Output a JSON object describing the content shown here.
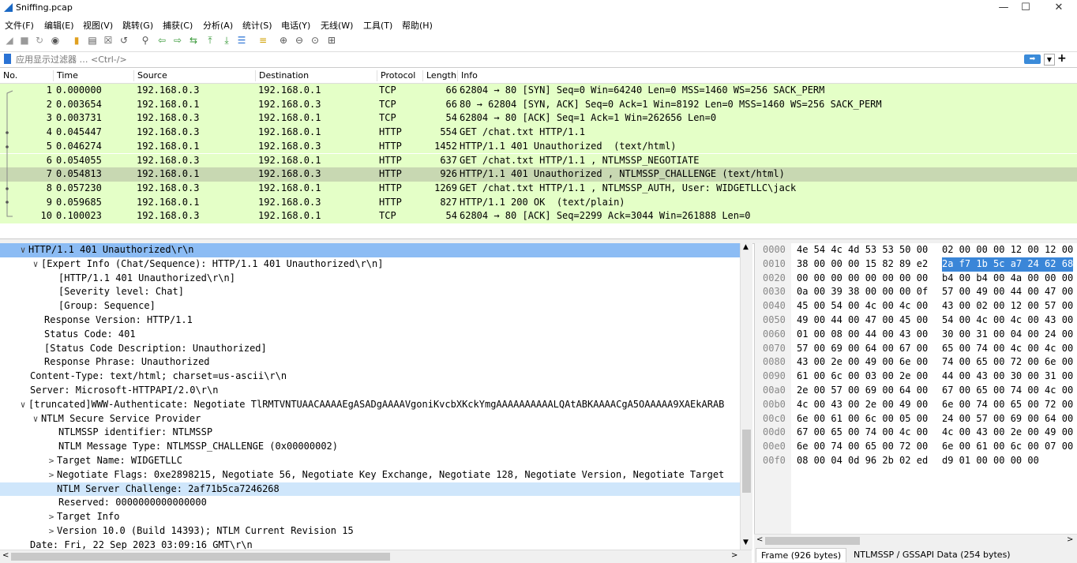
{
  "window": {
    "title": "Sniffing.pcap",
    "minimize": "—",
    "maximize": "☐",
    "close": "✕"
  },
  "menu": [
    "文件(F)",
    "编辑(E)",
    "视图(V)",
    "跳转(G)",
    "捕获(C)",
    "分析(A)",
    "统计(S)",
    "电话(Y)",
    "无线(W)",
    "工具(T)",
    "帮助(H)"
  ],
  "filter": {
    "placeholder": "应用显示过滤器 … <Ctrl-/>",
    "plus": "+"
  },
  "columns": [
    "No.",
    "Time",
    "Source",
    "Destination",
    "Protocol",
    "Length",
    "Info"
  ],
  "packets": [
    {
      "no": "1",
      "time": "0.000000",
      "src": "192.168.0.3",
      "dst": "192.168.0.1",
      "proto": "TCP",
      "len": "66",
      "info": "62804 → 80 [SYN] Seq=0 Win=64240 Len=0 MSS=1460 WS=256 SACK_PERM"
    },
    {
      "no": "2",
      "time": "0.003654",
      "src": "192.168.0.1",
      "dst": "192.168.0.3",
      "proto": "TCP",
      "len": "66",
      "info": "80 → 62804 [SYN, ACK] Seq=0 Ack=1 Win=8192 Len=0 MSS=1460 WS=256 SACK_PERM"
    },
    {
      "no": "3",
      "time": "0.003731",
      "src": "192.168.0.3",
      "dst": "192.168.0.1",
      "proto": "TCP",
      "len": "54",
      "info": "62804 → 80 [ACK] Seq=1 Ack=1 Win=262656 Len=0"
    },
    {
      "no": "4",
      "time": "0.045447",
      "src": "192.168.0.3",
      "dst": "192.168.0.1",
      "proto": "HTTP",
      "len": "554",
      "info": "GET /chat.txt HTTP/1.1"
    },
    {
      "no": "5",
      "time": "0.046274",
      "src": "192.168.0.1",
      "dst": "192.168.0.3",
      "proto": "HTTP",
      "len": "1452",
      "info": "HTTP/1.1 401 Unauthorized  (text/html)"
    },
    {
      "no": "6",
      "time": "0.054055",
      "src": "192.168.0.3",
      "dst": "192.168.0.1",
      "proto": "HTTP",
      "len": "637",
      "info": "GET /chat.txt HTTP/1.1 , NTLMSSP_NEGOTIATE"
    },
    {
      "no": "7",
      "time": "0.054813",
      "src": "192.168.0.1",
      "dst": "192.168.0.3",
      "proto": "HTTP",
      "len": "926",
      "info": "HTTP/1.1 401 Unauthorized , NTLMSSP_CHALLENGE (text/html)"
    },
    {
      "no": "8",
      "time": "0.057230",
      "src": "192.168.0.3",
      "dst": "192.168.0.1",
      "proto": "HTTP",
      "len": "1269",
      "info": "GET /chat.txt HTTP/1.1 , NTLMSSP_AUTH, User: WIDGETLLC\\jack"
    },
    {
      "no": "9",
      "time": "0.059685",
      "src": "192.168.0.1",
      "dst": "192.168.0.3",
      "proto": "HTTP",
      "len": "827",
      "info": "HTTP/1.1 200 OK  (text/plain)"
    },
    {
      "no": "10",
      "time": "0.100023",
      "src": "192.168.0.3",
      "dst": "192.168.0.1",
      "proto": "TCP",
      "len": "54",
      "info": "62804 → 80 [ACK] Seq=2299 Ack=3044 Win=261888 Len=0"
    }
  ],
  "selected_packet": "7",
  "details": [
    {
      "arrow": "∨",
      "text": "HTTP/1.1 401 Unauthorized\\r\\n",
      "state": "selected"
    },
    {
      "arrow": "∨",
      "text": "[Expert Info (Chat/Sequence): HTTP/1.1 401 Unauthorized\\r\\n]",
      "state": ""
    },
    {
      "arrow": "",
      "text": "[HTTP/1.1 401 Unauthorized\\r\\n]",
      "state": ""
    },
    {
      "arrow": "",
      "text": "[Severity level: Chat]",
      "state": ""
    },
    {
      "arrow": "",
      "text": "[Group: Sequence]",
      "state": ""
    },
    {
      "arrow": "",
      "text": "Response Version: HTTP/1.1",
      "state": ""
    },
    {
      "arrow": "",
      "text": "Status Code: 401",
      "state": ""
    },
    {
      "arrow": "",
      "text": "[Status Code Description: Unauthorized]",
      "state": ""
    },
    {
      "arrow": "",
      "text": "Response Phrase: Unauthorized",
      "state": ""
    },
    {
      "arrow": "",
      "text": "Content-Type: text/html; charset=us-ascii\\r\\n",
      "state": ""
    },
    {
      "arrow": "",
      "text": "Server: Microsoft-HTTPAPI/2.0\\r\\n",
      "state": ""
    },
    {
      "arrow": "∨",
      "text": "[truncated]WWW-Authenticate: Negotiate TlRMTVNTUAACAAAAEgASADgAAAAVgoniKvcbXKckYmgAAAAAAAAAALQAtABKAAAACgA5OAAAAA9XAEkARAB",
      "state": ""
    },
    {
      "arrow": "∨",
      "text": "NTLM Secure Service Provider",
      "state": ""
    },
    {
      "arrow": "",
      "text": "NTLMSSP identifier: NTLMSSP",
      "state": ""
    },
    {
      "arrow": "",
      "text": "NTLM Message Type: NTLMSSP_CHALLENGE (0x00000002)",
      "state": ""
    },
    {
      "arrow": ">",
      "text": "Target Name: WIDGETLLC",
      "state": ""
    },
    {
      "arrow": ">",
      "text": "Negotiate Flags: 0xe2898215, Negotiate 56, Negotiate Key Exchange, Negotiate 128, Negotiate Version, Negotiate Target",
      "state": ""
    },
    {
      "arrow": "",
      "text": "NTLM Server Challenge: 2af71b5ca7246268",
      "state": "highlight"
    },
    {
      "arrow": "",
      "text": "Reserved: 0000000000000000",
      "state": ""
    },
    {
      "arrow": ">",
      "text": "Target Info",
      "state": ""
    },
    {
      "arrow": ">",
      "text": "Version 10.0 (Build 14393); NTLM Current Revision 15",
      "state": ""
    },
    {
      "arrow": "",
      "text": "Date: Fri, 22 Sep 2023 03:09:16 GMT\\r\\n",
      "state": ""
    }
  ],
  "bytes": [
    {
      "off": "0000",
      "a": "4e 54 4c 4d 53 53 50 00",
      "b": "02 00 00 00 12 00 12 00",
      "hi": false
    },
    {
      "off": "0010",
      "a": "38 00 00 00 15 82 89 e2",
      "b": "2a f7 1b 5c a7 24 62 68",
      "hi": true
    },
    {
      "off": "0020",
      "a": "00 00 00 00 00 00 00 00",
      "b": "b4 00 b4 00 4a 00 00 00",
      "hi": false
    },
    {
      "off": "0030",
      "a": "0a 00 39 38 00 00 00 0f",
      "b": "57 00 49 00 44 00 47 00",
      "hi": false
    },
    {
      "off": "0040",
      "a": "45 00 54 00 4c 00 4c 00",
      "b": "43 00 02 00 12 00 57 00",
      "hi": false
    },
    {
      "off": "0050",
      "a": "49 00 44 00 47 00 45 00",
      "b": "54 00 4c 00 4c 00 43 00",
      "hi": false
    },
    {
      "off": "0060",
      "a": "01 00 08 00 44 00 43 00",
      "b": "30 00 31 00 04 00 24 00",
      "hi": false
    },
    {
      "off": "0070",
      "a": "57 00 69 00 64 00 67 00",
      "b": "65 00 74 00 4c 00 4c 00",
      "hi": false
    },
    {
      "off": "0080",
      "a": "43 00 2e 00 49 00 6e 00",
      "b": "74 00 65 00 72 00 6e 00",
      "hi": false
    },
    {
      "off": "0090",
      "a": "61 00 6c 00 03 00 2e 00",
      "b": "44 00 43 00 30 00 31 00",
      "hi": false
    },
    {
      "off": "00a0",
      "a": "2e 00 57 00 69 00 64 00",
      "b": "67 00 65 00 74 00 4c 00",
      "hi": false
    },
    {
      "off": "00b0",
      "a": "4c 00 43 00 2e 00 49 00",
      "b": "6e 00 74 00 65 00 72 00",
      "hi": false
    },
    {
      "off": "00c0",
      "a": "6e 00 61 00 6c 00 05 00",
      "b": "24 00 57 00 69 00 64 00",
      "hi": false
    },
    {
      "off": "00d0",
      "a": "67 00 65 00 74 00 4c 00",
      "b": "4c 00 43 00 2e 00 49 00",
      "hi": false
    },
    {
      "off": "00e0",
      "a": "6e 00 74 00 65 00 72 00",
      "b": "6e 00 61 00 6c 00 07 00",
      "hi": false
    },
    {
      "off": "00f0",
      "a": "08 00 04 0d 96 2b 02 ed",
      "b": "d9 01 00 00 00 00",
      "hi": false
    }
  ],
  "byte_tabs": [
    "Frame (926 bytes)",
    "NTLMSSP / GSSAPI Data (254 bytes)"
  ],
  "colors": {
    "tcp_row": "#e4ffc7",
    "selected_row": "#c8d8b2",
    "tree_selected": "#8cbcf4",
    "tree_highlight": "#cfe6fb",
    "byte_highlight": "#3a86d8"
  }
}
